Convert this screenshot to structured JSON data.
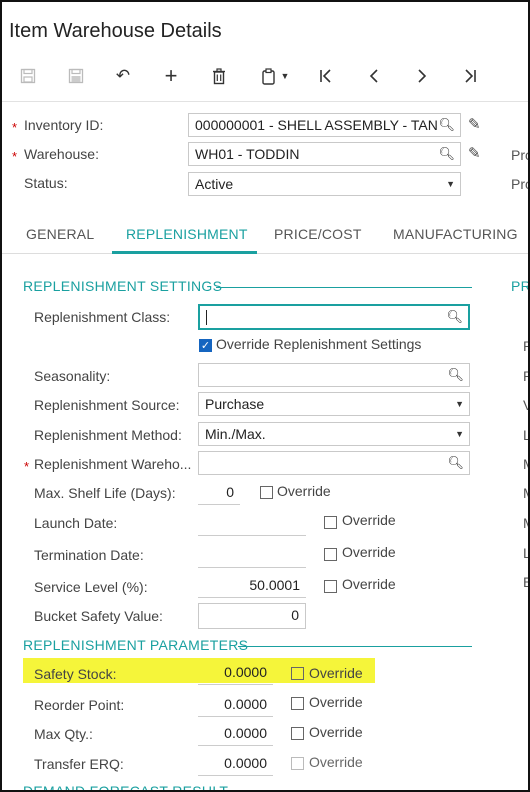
{
  "page": {
    "title": "Item Warehouse Details"
  },
  "toolbar": {
    "save_icon": "save-icon",
    "save_close_icon": "save-close-icon",
    "undo_icon": "↶",
    "add_icon": "+",
    "delete_icon": "trash-icon",
    "copy_icon": "clipboard-icon",
    "first_icon": "|<",
    "prev_icon": "<",
    "next_icon": ">",
    "last_icon": ">|"
  },
  "header": {
    "inventory_label": "Inventory ID:",
    "inventory_value": "000000001 - SHELL ASSEMBLY - TAN",
    "warehouse_label": "Warehouse:",
    "warehouse_value": "WH01 - TODDIN",
    "status_label": "Status:",
    "status_value": "Active",
    "right_label_1": "Pro",
    "right_label_2": "Pro"
  },
  "tabs": [
    "GENERAL",
    "REPLENISHMENT",
    "PRICE/COST",
    "MANUFACTURING"
  ],
  "settings": {
    "heading": "REPLENISHMENT SETTINGS",
    "right_heading": "PR",
    "class_label": "Replenishment Class:",
    "class_value": "",
    "override_settings_label": "Override Replenishment Settings",
    "seasonality_label": "Seasonality:",
    "seasonality_value": "",
    "source_label": "Replenishment Source:",
    "source_value": "Purchase",
    "method_label": "Replenishment Method:",
    "method_value": "Min./Max.",
    "warehouse_label": "Replenishment Wareho...",
    "warehouse_value": "",
    "shelf_label": "Max. Shelf Life (Days):",
    "shelf_value": "0",
    "launch_label": "Launch Date:",
    "termination_label": "Termination Date:",
    "service_label": "Service Level (%):",
    "service_value": "50.0001",
    "bucket_label": "Bucket Safety Value:",
    "bucket_value": "0",
    "override": "Override"
  },
  "right_letters": [
    "P",
    "P",
    "V",
    "L",
    "M",
    "M",
    "M",
    "L",
    "E"
  ],
  "parameters": {
    "heading": "REPLENISHMENT PARAMETERS",
    "safety_label": "Safety Stock:",
    "safety_value": "0.0000",
    "reorder_label": "Reorder Point:",
    "reorder_value": "0.0000",
    "maxqty_label": "Max Qty.:",
    "maxqty_value": "0.0000",
    "transfer_label": "Transfer ERQ:",
    "transfer_value": "0.0000",
    "override": "Override"
  },
  "demand": {
    "heading": "DEMAND FORECAST RESULT"
  },
  "colors": {
    "accent": "#1aa0a0",
    "highlight": "#f5f53a",
    "checkbox": "#1565c0"
  }
}
